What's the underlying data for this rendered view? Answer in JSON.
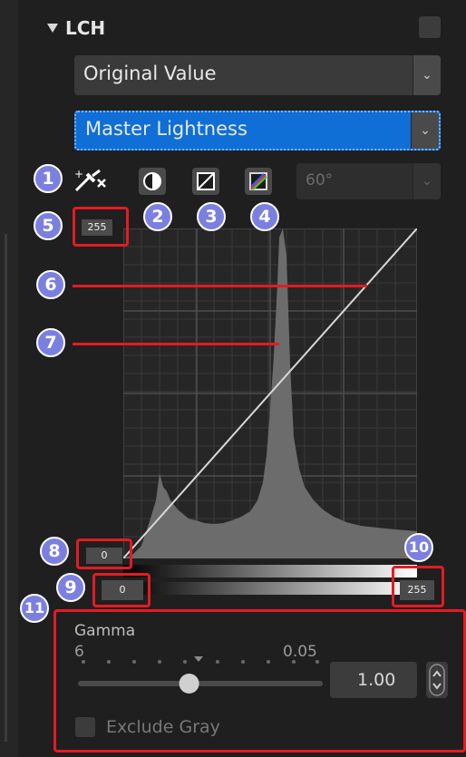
{
  "panel": {
    "title": "LCH",
    "dropdown1": {
      "value": "Original Value"
    },
    "dropdown2": {
      "value": "Master Lightness"
    },
    "angle": {
      "value": "60°"
    }
  },
  "curve": {
    "top_value": "255",
    "black_input": "0",
    "black_output": "0",
    "white_output": "255"
  },
  "gamma": {
    "label": "Gamma",
    "min_label": "6",
    "max_label": "0.05",
    "value": "1.00",
    "slider_fraction": 0.45
  },
  "exclude_gray": {
    "label": "Exclude Gray",
    "checked": false
  },
  "callouts": [
    "1",
    "2",
    "3",
    "4",
    "5",
    "6",
    "7",
    "8",
    "9",
    "10",
    "11"
  ],
  "colors": {
    "selected": "#0f6fd6",
    "callout": "#7b80e0",
    "highlight": "#e31b23"
  }
}
